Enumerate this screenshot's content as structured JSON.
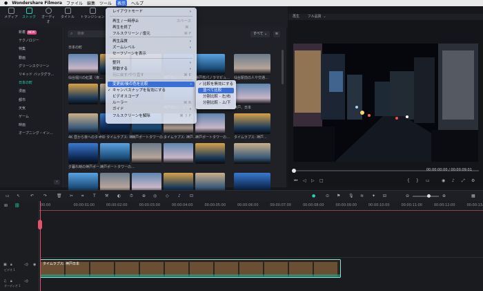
{
  "menubar": {
    "app": "Wondershare Filmora",
    "items": [
      "ファイル",
      "編集",
      "ツール",
      "表示",
      "ヘルプ"
    ],
    "active": "表示"
  },
  "toolbar": {
    "items": [
      {
        "label": "メディア"
      },
      {
        "label": "ストック"
      },
      {
        "label": "オーディオ"
      },
      {
        "label": "タイトル"
      },
      {
        "label": "トランジション"
      }
    ]
  },
  "sidebar": {
    "items": [
      "新着",
      "テクノロジー",
      "特集",
      "動画",
      "グリーンスクリーン",
      "リキッド バックグラ…",
      "日本の町",
      "漫画",
      "都市",
      "天気",
      "ゲーム",
      "映画",
      "オープニング・イン…"
    ],
    "selected": "日本の町",
    "new_badge": "NEW"
  },
  "search": {
    "placeholder": "検索",
    "filter": "すべて"
  },
  "grid": {
    "section_title": "日本の町",
    "captions": [
      "仙台堀川の紅葉（夜…",
      "",
      "",
      "神戸市/パノラマビュ…",
      "神戸市パノラマビュ…",
      "仙台駅前の人や交通…",
      "",
      "",
      "",
      "神戸市/パノラマビュ…",
      "HD タイムラプス: 神…",
      "神戸、日本",
      "4K 昼から夜へのタイ…",
      "HD タイムラプス: 神…",
      "神戸ポートタワーの…",
      "タイムラプス: 神戸…",
      "神戸ポートタワーの…",
      "タイムラプス: 神戸…",
      "夕暮れ時の神戸ポー…",
      "神戸ポートタワーの…",
      "",
      "",
      "",
      "",
      ""
    ]
  },
  "preview": {
    "tabs": [
      "再生",
      "フル品質"
    ],
    "time_current": "00:00:00:00",
    "time_total": "/ 00:00:09:01"
  },
  "timeline": {
    "ticks": [
      "00:00",
      "00:00:01:00",
      "00:00:02:00",
      "00:00:03:00",
      "00:00:04:00",
      "00:00:05:00",
      "00:00:06:00",
      "00:00:07:00",
      "00:00:08:00",
      "00:00:09:00",
      "00:00:10:00",
      "00:00:11:00",
      "00:00:12:00",
      "00:00:13:0"
    ],
    "clip_label": "タイムラプス: 神戸日本",
    "video_track": "ビデオ 1",
    "audio_track": "オーディオ 1"
  },
  "view_menu": {
    "items": [
      {
        "label": "レイアウトモード",
        "sc": "",
        "arrow": true
      },
      {
        "label": "再生 / 一時停止",
        "sc": "スペース"
      },
      {
        "label": "再生を終了",
        "sc": "⌘ ."
      },
      {
        "label": "フルスクリーン / 復元",
        "sc": "⌘ F"
      },
      {
        "label": "再生品質",
        "arrow": true
      },
      {
        "label": "ズームレベル",
        "arrow": true
      },
      {
        "label": "セーフゾーンを表示",
        "sc": ""
      },
      {
        "label": "整列",
        "arrow": true
      },
      {
        "label": "移動する",
        "arrow": true
      },
      {
        "label": "元に戻す/やり直す",
        "sc": "⌘ E",
        "disabled": true
      },
      {
        "label": "変更前/後の色を比較",
        "arrow": true
      },
      {
        "label": "キャンバスナップを有効にする",
        "check": true
      },
      {
        "label": "ビデオスコープ",
        "sc": ""
      },
      {
        "label": "ルーラー",
        "sc": "⌘ R"
      },
      {
        "label": "ガイド",
        "arrow": true
      },
      {
        "label": "フルスクリーンを解除",
        "sc": "⌘ ⇧ F"
      }
    ]
  },
  "compare_submenu": {
    "items": [
      "比較を無効にする",
      "並べて比較",
      "分割比較 - 左/右",
      "分割比較 - 上/下"
    ],
    "checked": "比較を無効にする",
    "highlighted": "並べて比較"
  },
  "colors": {
    "accent": "#2ed3b7",
    "menu_highlight": "#3a6fd8",
    "playhead": "#e3546c"
  }
}
